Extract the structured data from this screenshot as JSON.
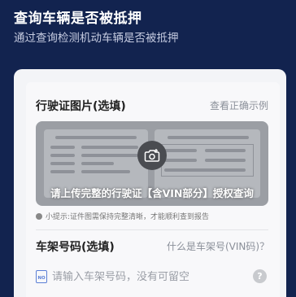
{
  "header": {
    "title": "查询车辆是否被抵押",
    "subtitle": "通过查询检测机动车辆是否被抵押"
  },
  "license_section": {
    "title": "行驶证图片(选填)",
    "example_link": "查看正确示例",
    "upload_text": "请上传完整的行驶证【含VIN部分】授权查询",
    "tip": "小提示:证件图需保持完整清晰，才能顺利查到报告"
  },
  "vin_section": {
    "title": "车架号码(选填)",
    "help_link": "什么是车架号(VIN码)？",
    "placeholder": "请输入车架号码，没有可留空",
    "icon_label": "NO",
    "help_symbol": "?"
  },
  "colors": {
    "header_bg": "#12234f",
    "accent": "#5b7fd6"
  }
}
